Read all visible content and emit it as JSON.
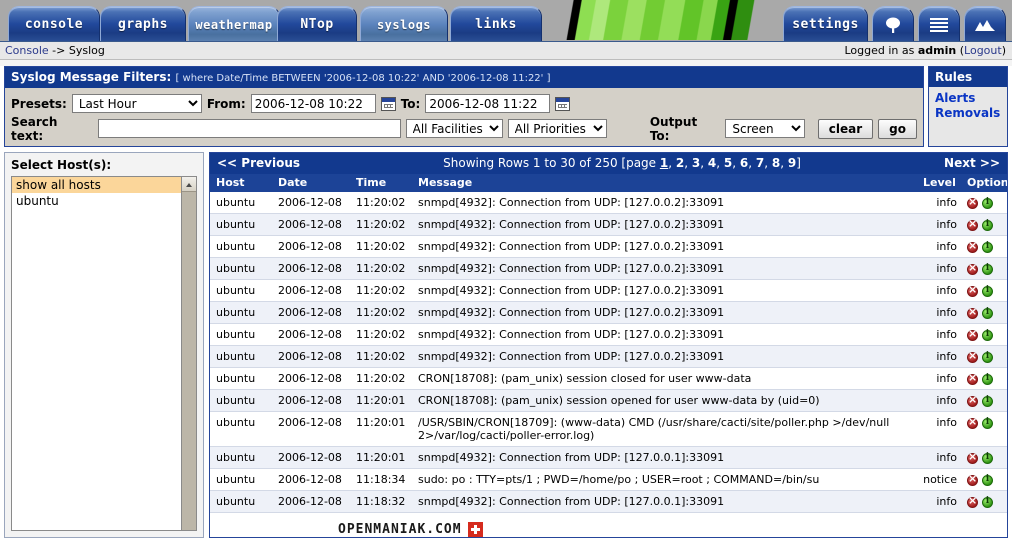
{
  "header": {
    "tabs": [
      {
        "label": "console",
        "style": "dark"
      },
      {
        "label": "graphs",
        "style": "dark"
      },
      {
        "label": "weathermap",
        "style": "light"
      },
      {
        "label": "NTop",
        "style": "dark"
      },
      {
        "label": "syslogs",
        "style": "light"
      },
      {
        "label": "links",
        "style": "dark"
      },
      {
        "label": "settings",
        "style": "dark"
      }
    ],
    "icon_tabs": [
      {
        "icon": "tree-icon"
      },
      {
        "icon": "list-icon"
      },
      {
        "icon": "graph-icon"
      }
    ]
  },
  "breadcrumb": {
    "root": "Console",
    "separator": " -> ",
    "current": "Syslog",
    "login_prefix": "Logged in as ",
    "login_user": "admin",
    "logout_open": " (",
    "logout_label": "Logout",
    "logout_close": ")"
  },
  "filters": {
    "title": "Syslog Message Filters:",
    "query": "[ where Date/Time BETWEEN '2006-12-08 10:22' AND '2006-12-08 11:22' ]",
    "presets_label": "Presets:",
    "presets_value": "Last Hour",
    "presets_options": [
      "Last Hour"
    ],
    "from_label": "From:",
    "from_value": "2006-12-08 10:22",
    "to_label": "To:",
    "to_value": "2006-12-08 11:22",
    "calendar_icon": "calendar-icon",
    "search_label": "Search text:",
    "search_value": "",
    "search_placeholder": "",
    "facilities_value": "All Facilities",
    "facilities_options": [
      "All Facilities"
    ],
    "priorities_value": "All Priorities",
    "priorities_options": [
      "All Priorities"
    ],
    "output_label": "Output To:",
    "output_value": "Screen",
    "output_options": [
      "Screen"
    ],
    "clear_label": "clear",
    "go_label": "go"
  },
  "rules": {
    "title": "Rules",
    "links": [
      "Alerts",
      "Removals"
    ]
  },
  "hosts": {
    "title": "Select Host(s):",
    "items": [
      {
        "label": "show all hosts",
        "selected": true
      },
      {
        "label": "ubuntu",
        "selected": false
      }
    ]
  },
  "pagination": {
    "previous": "<< Previous",
    "showing_prefix": "Showing Rows 1 to 30 of 250 [page ",
    "pages": [
      "1",
      "2",
      "3",
      "4",
      "5",
      "6",
      "7",
      "8",
      "9"
    ],
    "current_page": "1",
    "showing_suffix": "]",
    "next": "Next >>"
  },
  "table": {
    "columns": [
      "Host",
      "Date",
      "Time",
      "Message",
      "Level",
      "Options"
    ],
    "option_icons": [
      "delete-icon",
      "info-icon"
    ],
    "rows": [
      {
        "host": "ubuntu",
        "date": "2006-12-08",
        "time": "11:20:02",
        "message": "snmpd[4932]: Connection from UDP: [127.0.0.2]:33091",
        "level": "info"
      },
      {
        "host": "ubuntu",
        "date": "2006-12-08",
        "time": "11:20:02",
        "message": "snmpd[4932]: Connection from UDP: [127.0.0.2]:33091",
        "level": "info"
      },
      {
        "host": "ubuntu",
        "date": "2006-12-08",
        "time": "11:20:02",
        "message": "snmpd[4932]: Connection from UDP: [127.0.0.2]:33091",
        "level": "info"
      },
      {
        "host": "ubuntu",
        "date": "2006-12-08",
        "time": "11:20:02",
        "message": "snmpd[4932]: Connection from UDP: [127.0.0.2]:33091",
        "level": "info"
      },
      {
        "host": "ubuntu",
        "date": "2006-12-08",
        "time": "11:20:02",
        "message": "snmpd[4932]: Connection from UDP: [127.0.0.2]:33091",
        "level": "info"
      },
      {
        "host": "ubuntu",
        "date": "2006-12-08",
        "time": "11:20:02",
        "message": "snmpd[4932]: Connection from UDP: [127.0.0.2]:33091",
        "level": "info"
      },
      {
        "host": "ubuntu",
        "date": "2006-12-08",
        "time": "11:20:02",
        "message": "snmpd[4932]: Connection from UDP: [127.0.0.2]:33091",
        "level": "info"
      },
      {
        "host": "ubuntu",
        "date": "2006-12-08",
        "time": "11:20:02",
        "message": "snmpd[4932]: Connection from UDP: [127.0.0.2]:33091",
        "level": "info"
      },
      {
        "host": "ubuntu",
        "date": "2006-12-08",
        "time": "11:20:02",
        "message": "CRON[18708]: (pam_unix) session closed for user www-data",
        "level": "info"
      },
      {
        "host": "ubuntu",
        "date": "2006-12-08",
        "time": "11:20:01",
        "message": "CRON[18708]: (pam_unix) session opened for user www-data by (uid=0)",
        "level": "info"
      },
      {
        "host": "ubuntu",
        "date": "2006-12-08",
        "time": "11:20:01",
        "message": "/USR/SBIN/CRON[18709]: (www-data) CMD (/usr/share/cacti/site/poller.php >/dev/null 2>/var/log/cacti/poller-error.log)",
        "level": "info"
      },
      {
        "host": "ubuntu",
        "date": "2006-12-08",
        "time": "11:20:01",
        "message": "snmpd[4932]: Connection from UDP: [127.0.0.1]:33091",
        "level": "info"
      },
      {
        "host": "ubuntu",
        "date": "2006-12-08",
        "time": "11:18:34",
        "message": "sudo: po : TTY=pts/1 ; PWD=/home/po ; USER=root ; COMMAND=/bin/su",
        "level": "notice"
      },
      {
        "host": "ubuntu",
        "date": "2006-12-08",
        "time": "11:18:32",
        "message": "snmpd[4932]: Connection from UDP: [127.0.0.1]:33091",
        "level": "info"
      }
    ]
  },
  "watermark": {
    "text": "OPENMANIAK.COM",
    "flag_icon": "swiss-flag-icon"
  },
  "colors": {
    "tab_blue": "#22499c",
    "panel_header": "#12398e",
    "link_blue": "#0a35c4",
    "selection_orange": "#fbd69a",
    "row_alt": "#eef1f8",
    "banner_green": "#7bd23c"
  }
}
